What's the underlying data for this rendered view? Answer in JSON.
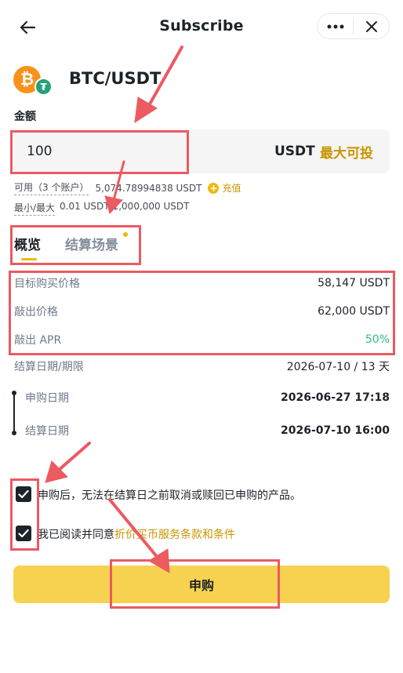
{
  "header": {
    "title": "Subscribe"
  },
  "pair": {
    "name": "BTC/USDT",
    "base_glyph": "₿",
    "quote_glyph": "₮"
  },
  "amount": {
    "label": "金额",
    "value": "100",
    "unit": "USDT",
    "max_label": "最大可投"
  },
  "balance": {
    "available_label": "可用（3 个账户）",
    "available_value": "5,074.78994838 USDT",
    "topup_label": "充值",
    "minmax_label": "最小/最大",
    "minmax_value": "0.01 USDT/1,000,000 USDT"
  },
  "tabs": [
    {
      "label": "概览"
    },
    {
      "label": "结算场景"
    }
  ],
  "details": [
    {
      "label": "目标购买价格",
      "value": "58,147 USDT"
    },
    {
      "label": "敲出价格",
      "value": "62,000 USDT"
    },
    {
      "label": "敲出 APR",
      "value": "50%"
    },
    {
      "label": "结算日期/期限",
      "value": "2026-07-10 / 13 天"
    }
  ],
  "timeline": [
    {
      "label": "申购日期",
      "value": "2026-06-27 17:18"
    },
    {
      "label": "结算日期",
      "value": "2026-07-10 16:00"
    }
  ],
  "agreements": {
    "first": "申购后，无法在结算日之前取消或赎回已申购的产品。",
    "second_prefix": "我已阅读并同意",
    "second_link": "折价买币服务条款和条件"
  },
  "submit_label": "申购",
  "colors": {
    "accent": "#f0b90b",
    "link": "#c99400",
    "positive": "#2ebd85",
    "button": "#f7d250",
    "annotation": "#ec5a62"
  }
}
